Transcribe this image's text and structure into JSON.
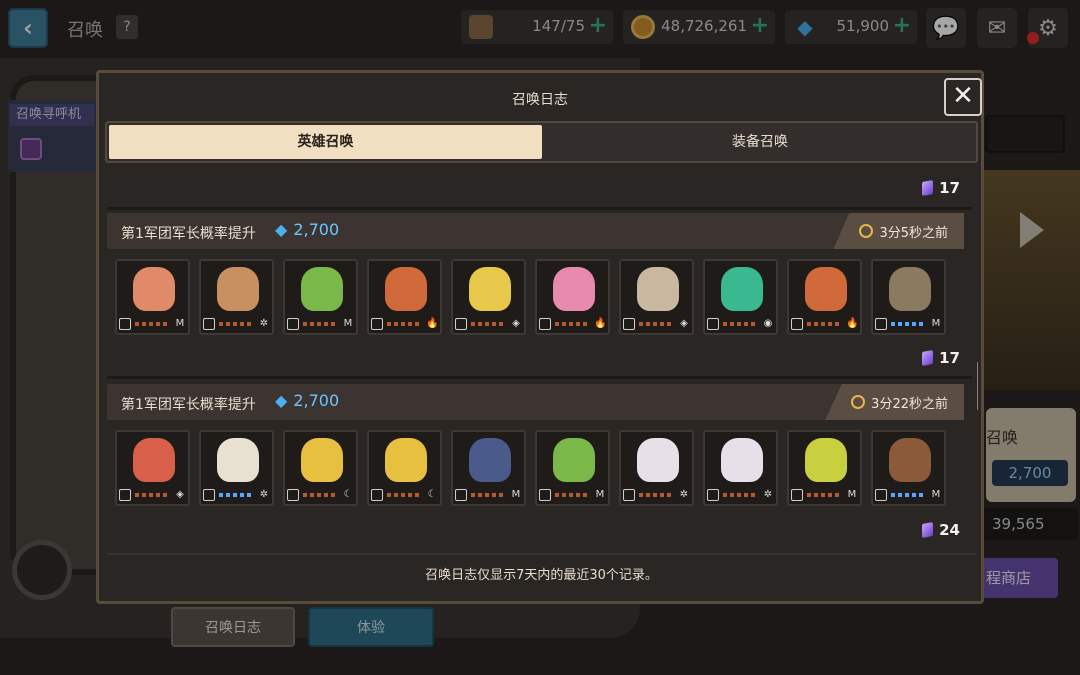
{
  "topbar": {
    "title": "召唤",
    "help": "?",
    "stamina": "147/75",
    "gold": "48,726,261",
    "gems": "51,900",
    "plus": "+"
  },
  "background": {
    "side_panel_title": "召唤寻呼机",
    "summon_label": "召唤",
    "summon_price": "2,700",
    "field_value": "39,565",
    "shop_label": "程商店"
  },
  "modal": {
    "title": "召唤日志",
    "close": "✕",
    "tabs": [
      "英雄召唤",
      "装备召唤"
    ],
    "footer": "召唤日志仅显示7天内的最近30个记录。"
  },
  "records": [
    {
      "top_count": "17"
    },
    {
      "title": "第1军团军长概率提升",
      "price": "2,700",
      "time": "3分5秒之前",
      "count": "17",
      "heroes": [
        {
          "color": "#e08a6a",
          "stars": "orange",
          "element": "M"
        },
        {
          "color": "#c89060",
          "stars": "orange",
          "element": "✲"
        },
        {
          "color": "#7ab84a",
          "stars": "orange",
          "element": "M"
        },
        {
          "color": "#d06a3a",
          "stars": "orange",
          "element": "🔥"
        },
        {
          "color": "#e8c84a",
          "stars": "orange",
          "element": "◈"
        },
        {
          "color": "#e88ab0",
          "stars": "orange",
          "element": "🔥"
        },
        {
          "color": "#c8b8a0",
          "stars": "orange",
          "element": "◈"
        },
        {
          "color": "#3ab890",
          "stars": "orange",
          "element": "◉"
        },
        {
          "color": "#d06a3a",
          "stars": "orange",
          "element": "🔥"
        },
        {
          "color": "#8a7a60",
          "stars": "blue",
          "element": "M"
        }
      ]
    },
    {
      "title": "第1军团军长概率提升",
      "price": "2,700",
      "time": "3分22秒之前",
      "count": "24",
      "heroes": [
        {
          "color": "#d8604a",
          "stars": "orange",
          "element": "◈"
        },
        {
          "color": "#e8e0d0",
          "stars": "blue",
          "element": "✲"
        },
        {
          "color": "#e8c040",
          "stars": "orange",
          "element": "☾"
        },
        {
          "color": "#e8c040",
          "stars": "orange",
          "element": "☾"
        },
        {
          "color": "#4a5a8a",
          "stars": "orange",
          "element": "M"
        },
        {
          "color": "#7ab84a",
          "stars": "orange",
          "element": "M"
        },
        {
          "color": "#e8e0e8",
          "stars": "orange",
          "element": "✲"
        },
        {
          "color": "#e8e0e8",
          "stars": "orange",
          "element": "✲"
        },
        {
          "color": "#c8d040",
          "stars": "orange",
          "element": "M"
        },
        {
          "color": "#8a5a3a",
          "stars": "blue",
          "element": "M"
        }
      ]
    }
  ],
  "bottom": {
    "log_button": "召唤日志",
    "trial_button": "体验"
  }
}
